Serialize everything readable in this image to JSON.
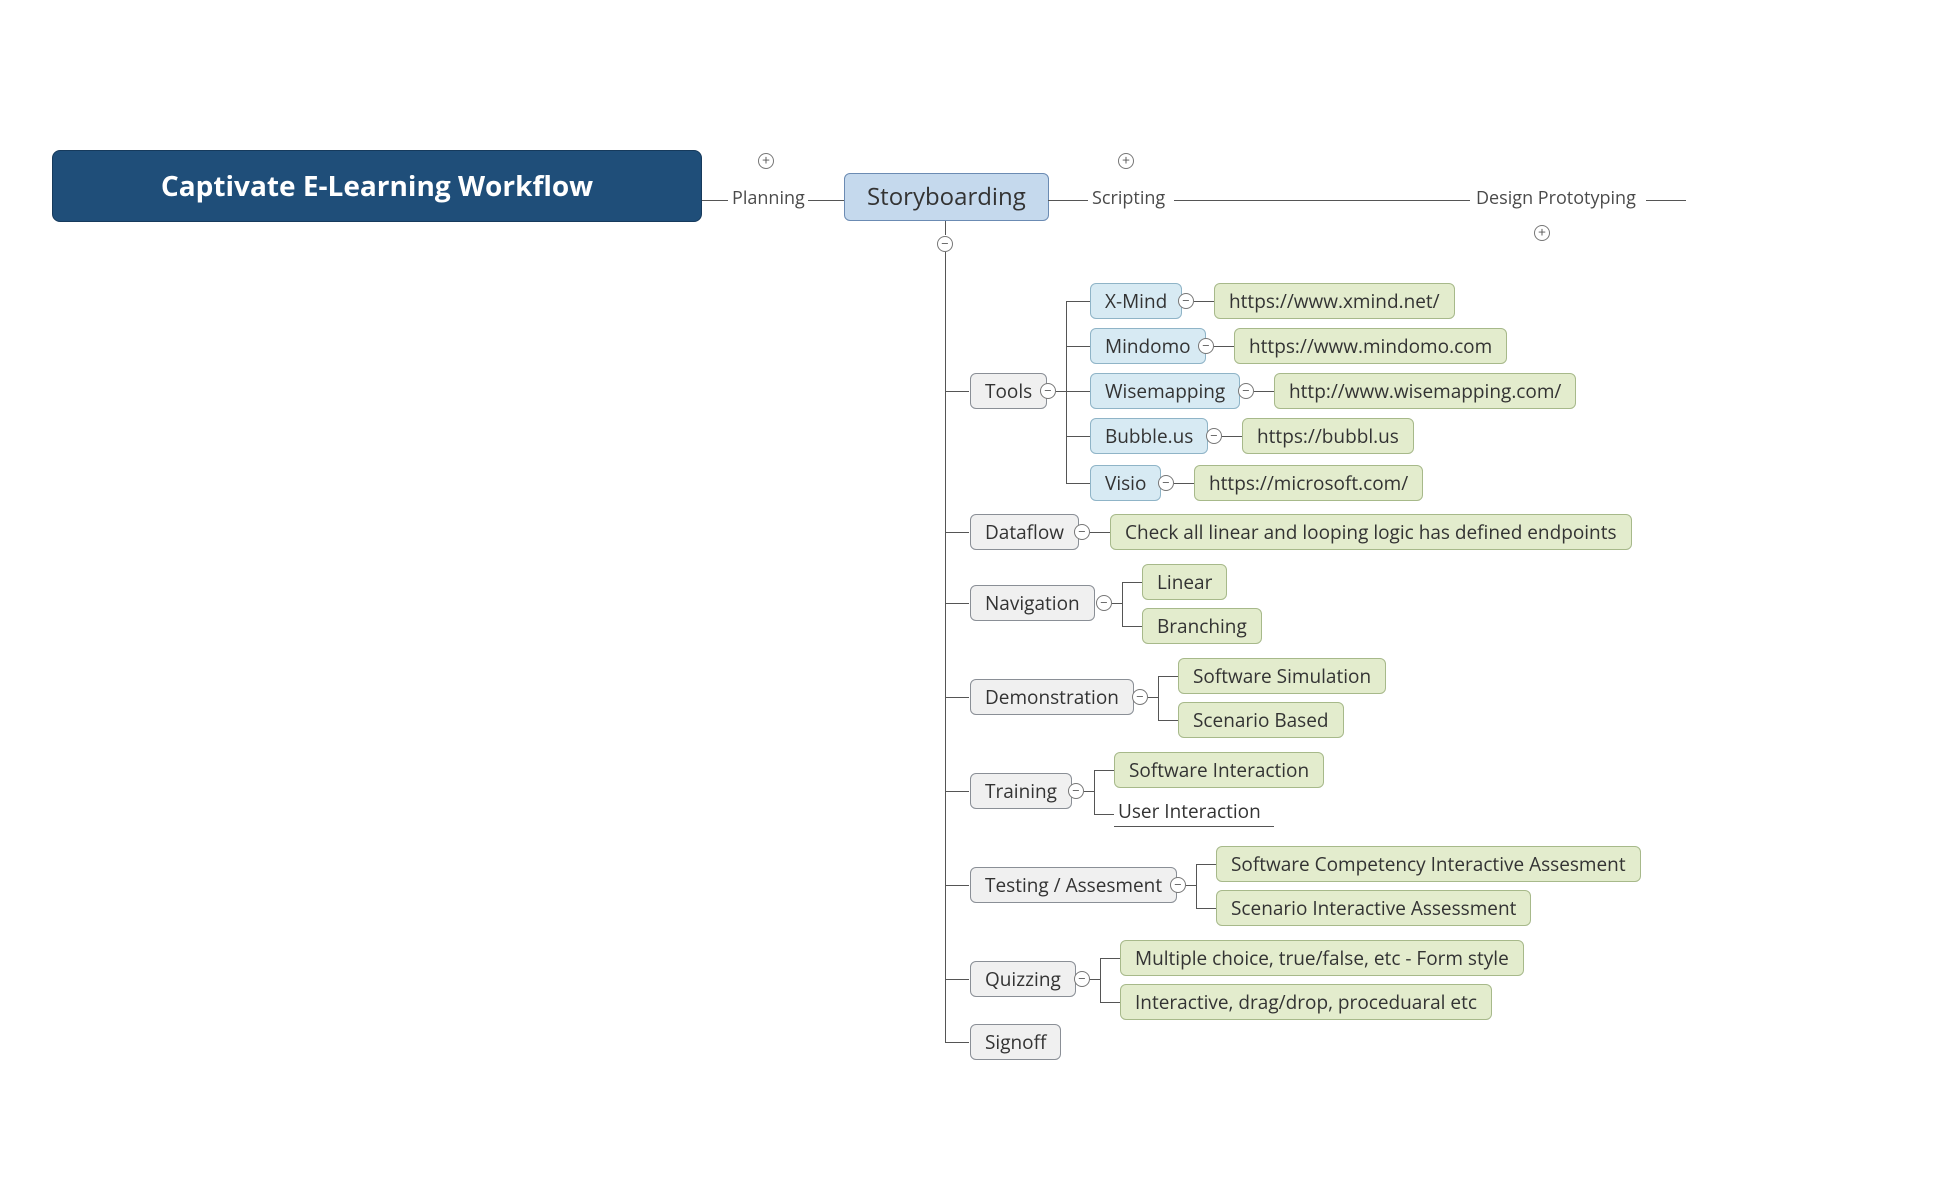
{
  "root": {
    "title": "Captivate E-Learning Workflow"
  },
  "stages": {
    "planning": "Planning",
    "storyboard": "Storyboarding",
    "scripting": "Scripting",
    "design": "Design Prototyping"
  },
  "storyboard_children": {
    "tools": {
      "label": "Tools"
    },
    "dataflow": {
      "label": "Dataflow",
      "note": "Check all linear and looping logic has defined endpoints"
    },
    "nav": {
      "label": "Navigation",
      "opts": [
        "Linear",
        "Branching"
      ]
    },
    "demo": {
      "label": "Demonstration",
      "opts": [
        "Software Simulation",
        "Scenario Based"
      ]
    },
    "train": {
      "label": "Training",
      "opts": [
        "Software Interaction",
        "User Interaction"
      ]
    },
    "test": {
      "label": "Testing / Assesment",
      "opts": [
        "Software Competency Interactive Assesment",
        "Scenario Interactive Assessment"
      ]
    },
    "quiz": {
      "label": "Quizzing",
      "opts": [
        "Multiple choice, true/false, etc - Form style",
        "Interactive, drag/drop, proceduaral etc"
      ]
    },
    "signoff": {
      "label": "Signoff"
    }
  },
  "tools": {
    "xmind": {
      "name": "X-Mind",
      "url": "https://www.xmind.net/"
    },
    "mindomo": {
      "name": "Mindomo",
      "url": "https://www.mindomo.com"
    },
    "wise": {
      "name": "Wisemapping",
      "url": "http://www.wisemapping.com/"
    },
    "bubble": {
      "name": "Bubble.us",
      "url": "https://bubbl.us"
    },
    "visio": {
      "name": "Visio",
      "url": "https://microsoft.com/"
    }
  }
}
